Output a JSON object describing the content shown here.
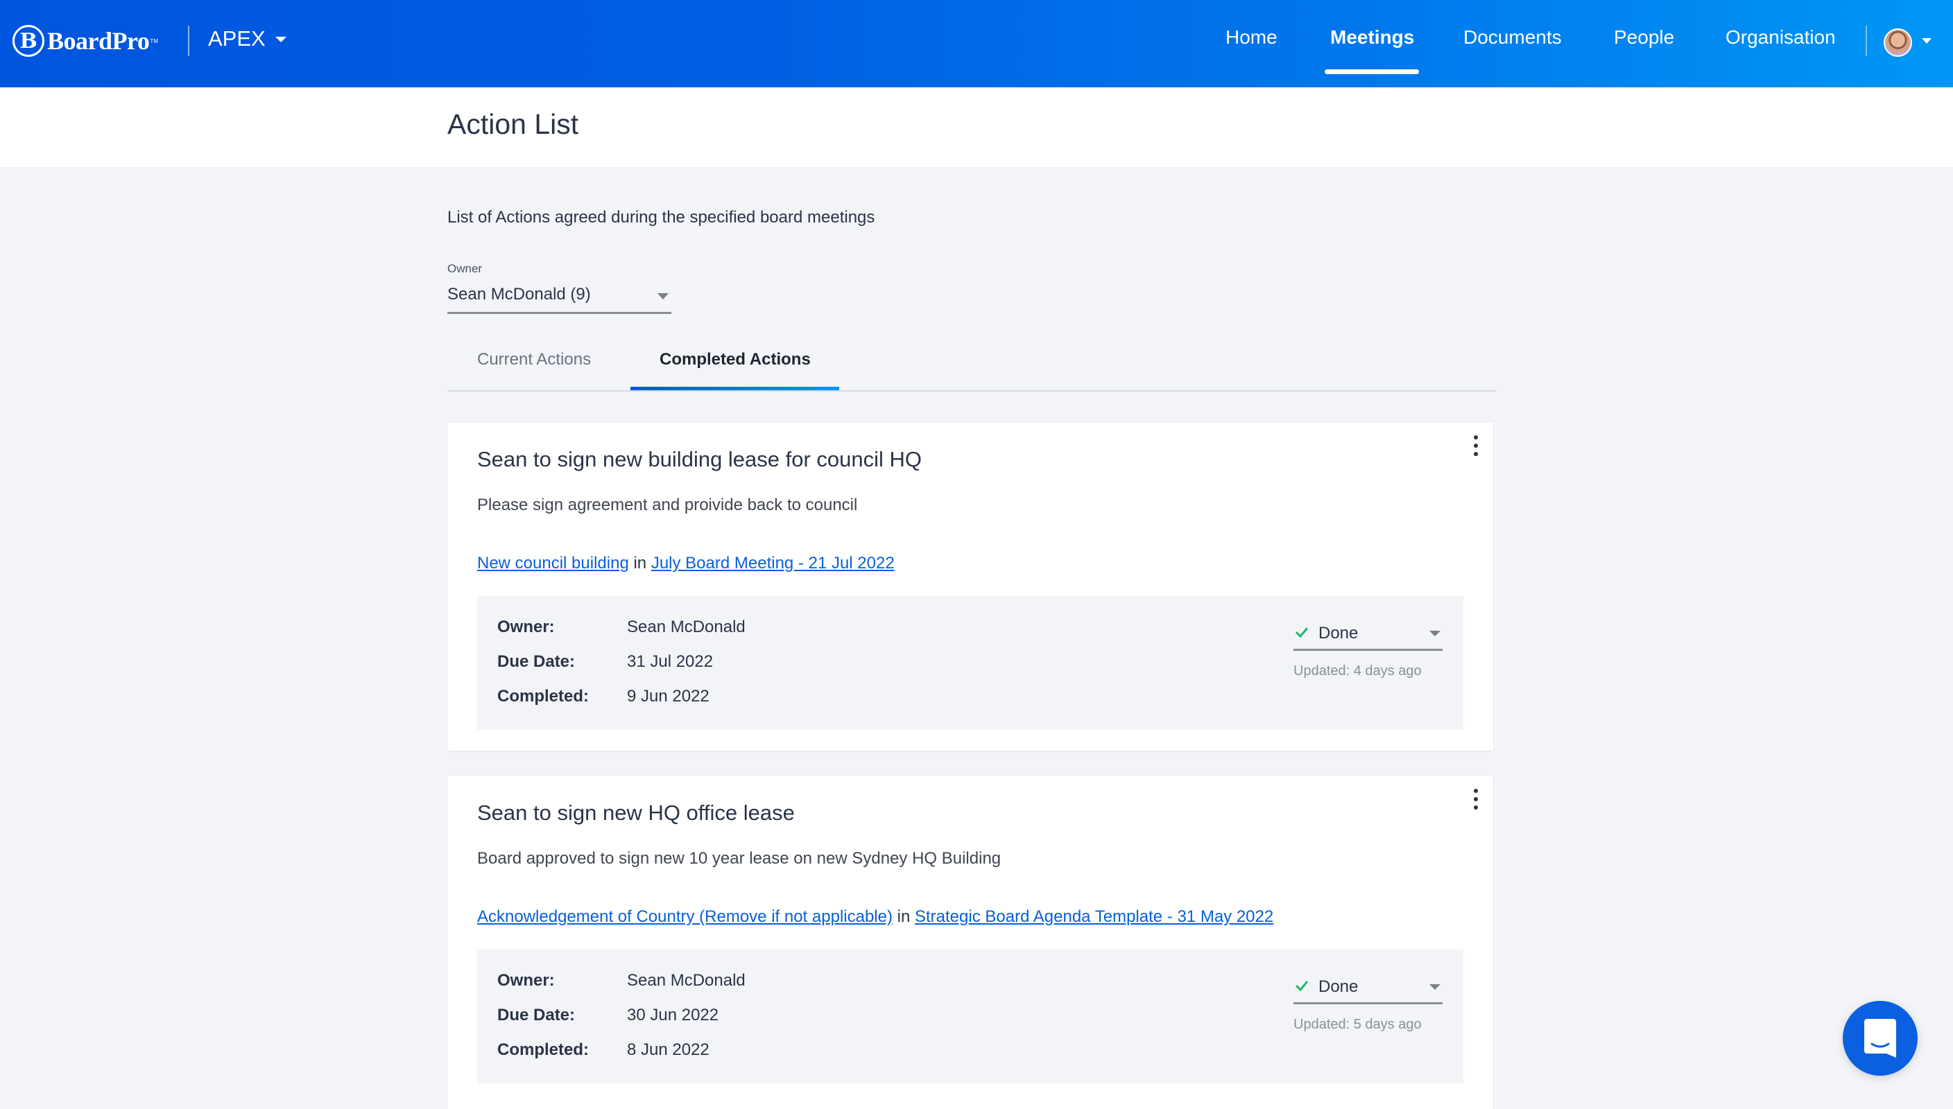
{
  "header": {
    "brand": "BoardPro",
    "brand_tm": "TM",
    "org": "APEX",
    "nav": [
      {
        "label": "Home",
        "active": false
      },
      {
        "label": "Meetings",
        "active": true
      },
      {
        "label": "Documents",
        "active": false
      },
      {
        "label": "People",
        "active": false
      },
      {
        "label": "Organisation",
        "active": false
      }
    ]
  },
  "page": {
    "title": "Action List",
    "description": "List of Actions agreed during the specified board meetings",
    "owner_filter": {
      "label": "Owner",
      "value": "Sean McDonald (9)"
    },
    "tabs": [
      {
        "label": "Current Actions",
        "active": false
      },
      {
        "label": "Completed Actions",
        "active": true
      }
    ]
  },
  "actions": [
    {
      "title": "Sean to sign new building lease for council HQ",
      "description": "Please sign agreement and proivide back to council",
      "agenda_item": "New council building",
      "link_joiner": "in",
      "meeting": "July Board Meeting - 21 Jul 2022",
      "owner_label": "Owner:",
      "owner": "Sean McDonald",
      "due_label": "Due Date:",
      "due": "31 Jul 2022",
      "completed_label": "Completed:",
      "completed": "9 Jun 2022",
      "status": "Done",
      "updated": "Updated: 4 days ago"
    },
    {
      "title": "Sean to sign new HQ office lease",
      "description": "Board approved to sign new 10 year lease on new Sydney HQ Building",
      "agenda_item": "Acknowledgement of Country (Remove if not applicable)",
      "link_joiner": "in",
      "meeting": "Strategic Board Agenda Template - 31 May 2022",
      "owner_label": "Owner:",
      "owner": "Sean McDonald",
      "due_label": "Due Date:",
      "due": "30 Jun 2022",
      "completed_label": "Completed:",
      "completed": "8 Jun 2022",
      "status": "Done",
      "updated": "Updated: 5 days ago"
    }
  ],
  "colors": {
    "brand_blue": "#0055de",
    "link": "#0a5fd8",
    "done_check": "#1db96a"
  }
}
